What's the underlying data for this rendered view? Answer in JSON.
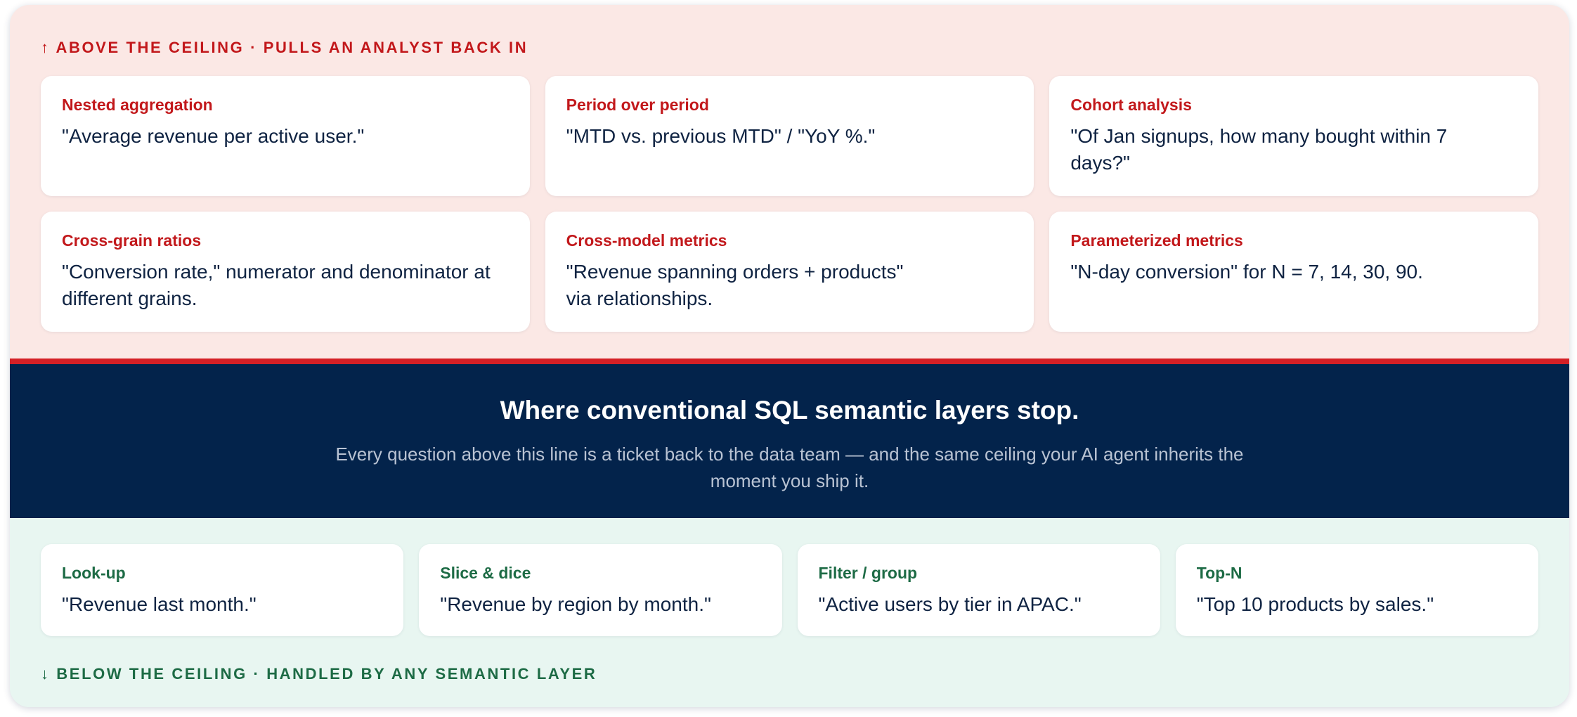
{
  "above": {
    "label": "↑ ABOVE THE CEILING · PULLS AN ANALYST BACK IN",
    "cards": [
      {
        "title": "Nested aggregation",
        "text": "\"Average revenue per active user.\""
      },
      {
        "title": "Period over period",
        "text": "\"MTD vs. previous MTD\" / \"YoY %.\""
      },
      {
        "title": "Cohort analysis",
        "text": "\"Of Jan signups, how many bought within 7 days?\""
      },
      {
        "title": "Cross-grain ratios",
        "text": "\"Conversion rate,\" numerator and denominator at different grains."
      },
      {
        "title": "Cross-model metrics",
        "text": "\"Revenue spanning orders + products\" via relationships."
      },
      {
        "title": "Parameterized metrics",
        "text": "\"N-day conversion\" for N = 7, 14, 30, 90."
      }
    ]
  },
  "ceiling": {
    "title": "Where conventional SQL semantic layers stop.",
    "subtitle": "Every question above this line is a ticket back to the data team — and the same ceiling your AI agent inherits the moment you ship it."
  },
  "below": {
    "label": "↓ BELOW THE CEILING · HANDLED BY ANY SEMANTIC LAYER",
    "cards": [
      {
        "title": "Look-up",
        "text": "\"Revenue last month.\""
      },
      {
        "title": "Slice & dice",
        "text": "\"Revenue by region by month.\""
      },
      {
        "title": "Filter / group",
        "text": "\"Active users by tier in APAC.\""
      },
      {
        "title": "Top-N",
        "text": "\"Top 10 products by sales.\""
      }
    ]
  },
  "colors": {
    "above_bg": "#fbe8e5",
    "above_accent": "#c2181b",
    "ceiling_bg": "#03234b",
    "ceiling_line": "#d42026",
    "below_bg": "#e8f6f1",
    "below_accent": "#1d6b45",
    "card_text": "#0f2342"
  }
}
